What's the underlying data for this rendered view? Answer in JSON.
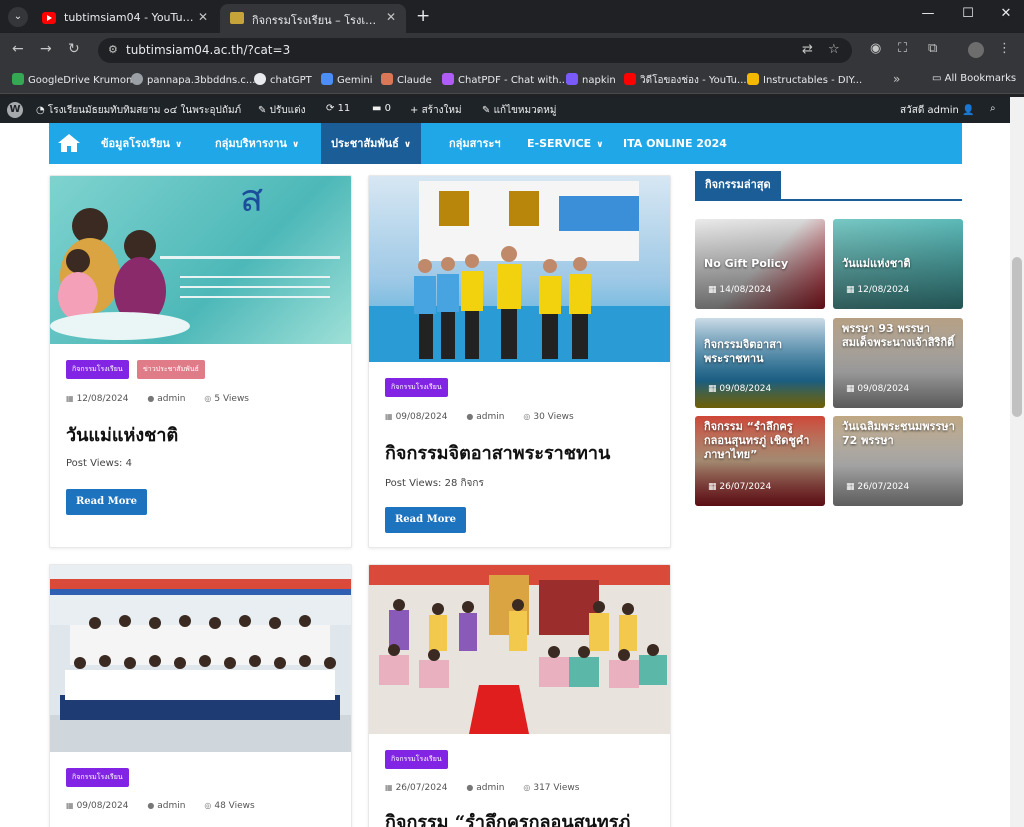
{
  "browser": {
    "tabs": [
      {
        "title": "tubtimsiam04 - YouTube",
        "active": false
      },
      {
        "title": "กิจกรรมโรงเรียน – โรงเรียนมัธยมทับทิมสยาม ๐๔",
        "active": true
      }
    ],
    "url": "tubtimsiam04.ac.th/?cat=3",
    "bookmarks": [
      {
        "label": "GoogleDrive Krumon",
        "color": "#34a853"
      },
      {
        "label": "pannapa.3bbddns.c...",
        "color": "#9aa0a6"
      },
      {
        "label": "chatGPT",
        "color": "#e8eaed"
      },
      {
        "label": "Gemini",
        "color": "#4c8df6"
      },
      {
        "label": "Claude",
        "color": "#d97757"
      },
      {
        "label": "ChatPDF - Chat with...",
        "color": "#b05cf6"
      },
      {
        "label": "napkin",
        "color": "#7a5af8"
      },
      {
        "label": "วิดีโอของช่อง - YouTu...",
        "color": "#ff0000"
      },
      {
        "label": "Instructables - DIY...",
        "color": "#f5b800"
      }
    ],
    "all_bookmarks": "All Bookmarks"
  },
  "wp_admin": {
    "site_name": "โรงเรียนมัธยมทับทิมสยาม ๐๔ ในพระอุปถัมภ์",
    "customize": "ปรับแต่ง",
    "updates": "11",
    "comments": "0",
    "new": "สร้างใหม่",
    "edit_category": "แก้ไขหมวดหมู่",
    "greeting": "สวัสดี admin"
  },
  "menu": {
    "items": [
      {
        "label": "ข้อมูลโรงเรียน",
        "caret": true,
        "active": false
      },
      {
        "label": "กลุ่มบริหารงาน",
        "caret": true,
        "active": false
      },
      {
        "label": "ประชาสัมพันธ์",
        "caret": true,
        "active": true
      },
      {
        "label": "กลุ่มสาระฯ",
        "caret": false,
        "active": false
      },
      {
        "label": "E-SERVICE",
        "caret": true,
        "active": false
      },
      {
        "label": "ITA ONLINE 2024",
        "caret": false,
        "active": false
      }
    ]
  },
  "posts": [
    {
      "image_desc": "banner",
      "badges": [
        {
          "label": "กิจกรรมโรงเรียน",
          "color": "#8224e3"
        },
        {
          "label": "ข่าวประชาสัมพันธ์",
          "color": "#e07b88"
        }
      ],
      "date": "12/08/2024",
      "author": "admin",
      "views": "5 Views",
      "title": "วันแม่แห่งชาติ",
      "post_views": "Post Views: 4",
      "read_more": "Read More"
    },
    {
      "badges": [
        {
          "label": "กิจกรรมโรงเรียน",
          "color": "#8224e3"
        }
      ],
      "date": "09/08/2024",
      "author": "admin",
      "views": "30 Views",
      "title": "กิจกรรมจิตอาสาพระราชทาน",
      "post_views": "Post Views: 28 กิจกร",
      "read_more": "Read More"
    },
    {
      "badges": [
        {
          "label": "กิจกรรมโรงเรียน",
          "color": "#8224e3"
        }
      ],
      "date": "09/08/2024",
      "author": "admin",
      "views": "48 Views"
    },
    {
      "badges": [
        {
          "label": "กิจกรรมโรงเรียน",
          "color": "#8224e3"
        }
      ],
      "date": "26/07/2024",
      "author": "admin",
      "views": "317 Views",
      "title": "กิจกรรม “รำลึกครูกลอนสุนทรภู่"
    }
  ],
  "sidebar": {
    "heading": "กิจกรรมล่าสุด",
    "items": [
      {
        "title": "No Gift Policy",
        "date": "14/08/2024"
      },
      {
        "title": "วันแม่แห่งชาติ",
        "date": "12/08/2024"
      },
      {
        "title": "กิจกรรมจิตอาสาพระราชทาน",
        "date": "09/08/2024"
      },
      {
        "title": "พรรษา 93 พรรษา สมเด็จพระนางเจ้าสิริกิติ์",
        "date": "09/08/2024"
      },
      {
        "title": "กิจกรรม “รำลึกครูกลอนสุนทรภู่ เชิดชูคำภาษาไทย”",
        "date": "26/07/2024"
      },
      {
        "title": "วันเฉลิมพระชนมพรรษา 72 พรรษา",
        "date": "26/07/2024"
      }
    ]
  }
}
